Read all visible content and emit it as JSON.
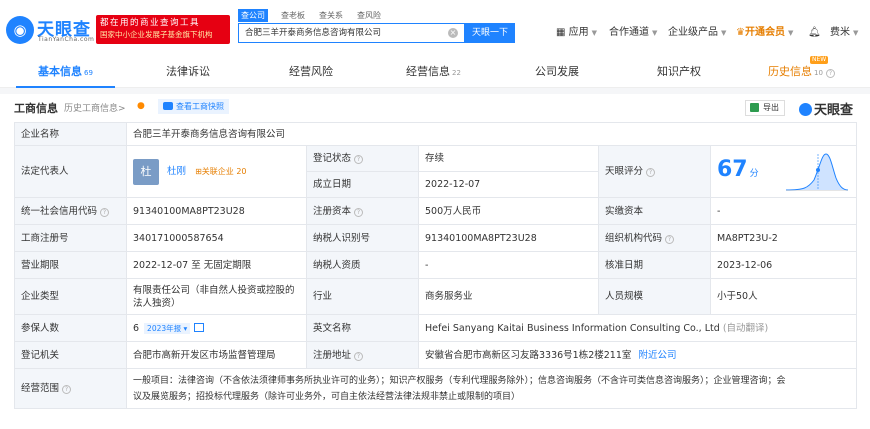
{
  "header": {
    "logo_text": "天眼查",
    "logo_domain": "TianYanCha.com",
    "banner_line1": "国家中小企业发展子基金旗下机构",
    "banner_line0": "都在用的商业查询工具",
    "search_tabs": [
      "查公司",
      "查老板",
      "查关系",
      "查风险"
    ],
    "search_value": "合肥三羊开泰商务信息咨询有限公司",
    "search_button": "天眼一下",
    "nav": {
      "app": "应用",
      "channel": "合作通道",
      "enterprise": "企业级产品",
      "vip": "开通会员",
      "user": "费米"
    }
  },
  "tabs": [
    {
      "label": "基本信息",
      "count": "69"
    },
    {
      "label": "法律诉讼",
      "count": ""
    },
    {
      "label": "经营风险",
      "count": ""
    },
    {
      "label": "经营信息",
      "count": "22"
    },
    {
      "label": "公司发展",
      "count": ""
    },
    {
      "label": "知识产权",
      "count": ""
    },
    {
      "label": "历史信息",
      "count": "10"
    }
  ],
  "new_badge": "NEW",
  "section": {
    "title": "工商信息",
    "history": "历史工商信息>",
    "snapshot": "查看工商快照",
    "export": "导出",
    "watermark": "天眼查"
  },
  "company": {
    "name_label": "企业名称",
    "name": "合肥三羊开泰商务信息咨询有限公司",
    "legal_label": "法定代表人",
    "legal_avatar": "杜",
    "legal_name": "杜刚",
    "related_label": "关联企业",
    "related_count": "20",
    "reg_status_label": "登记状态",
    "reg_status": "存续",
    "setup_label": "成立日期",
    "setup_date": "2022-12-07",
    "score_label": "天眼评分",
    "score": "67",
    "score_unit": "分",
    "credit_label": "统一社会信用代码",
    "credit_code": "91340100MA8PT23U28",
    "capital_label": "注册资本",
    "capital": "500万人民币",
    "paid_label": "实缴资本",
    "paid": "-",
    "regno_label": "工商注册号",
    "regno": "340171000587654",
    "taxid_label": "纳税人识别号",
    "taxid": "91340100MA8PT23U28",
    "orgcode_label": "组织机构代码",
    "orgcode": "MA8PT23U-2",
    "term_label": "营业期限",
    "term": "2022-12-07 至 无固定期限",
    "taxq_label": "纳税人资质",
    "taxq": "-",
    "approve_label": "核准日期",
    "approve_date": "2023-12-06",
    "type_label": "企业类型",
    "type_line1": "有限责任公司（非自然人投资或控股的",
    "type_line2": "法人独资）",
    "industry_label": "行业",
    "industry": "商务服务业",
    "staff_label": "人员规模",
    "staff": "小于50人",
    "insured_label": "参保人数",
    "insured": "6",
    "insured_year": "2023年报",
    "en_label": "英文名称",
    "en_name": "Hefei Sanyang Kaitai Business Information Consulting Co., Ltd",
    "en_note": "(自动翻译)",
    "authority_label": "登记机关",
    "authority": "合肥市高新开发区市场监督管理局",
    "addr_label": "注册地址",
    "address": "安徽省合肥市高新区习友路3336号1栋2楼211室",
    "addr_link": "附近公司",
    "scope_label": "经营范围",
    "scope_line1": "一般项目：法律咨询（不含依法须律师事务所执业许可的业务）；知识产权服务（专利代理服务除外）；信息咨询服务（不含许可类信息咨询服务）；企业管理咨询；会",
    "scope_line2": "议及展览服务；招投标代理服务（除许可业务外，可自主依法经营法律法规非禁止或限制的项目）"
  },
  "colors": {
    "brand": "#1f83ff",
    "vip": "#e67e00",
    "status": "#2d9b4f",
    "banner": "#e60012"
  }
}
